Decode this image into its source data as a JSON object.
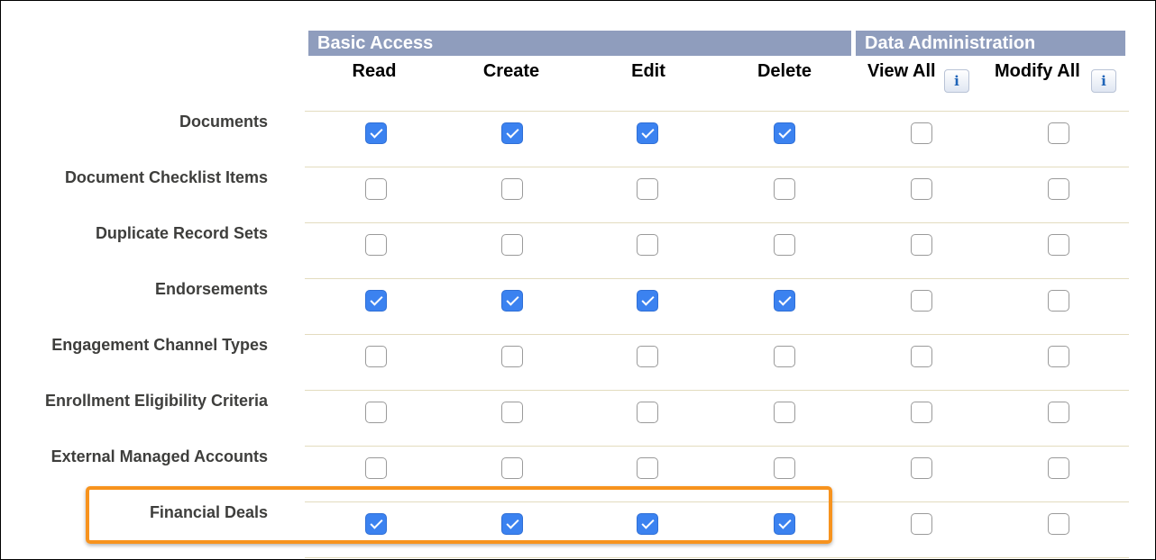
{
  "header": {
    "basic_access": "Basic Access",
    "data_administration": "Data Administration"
  },
  "columns": [
    "Read",
    "Create",
    "Edit",
    "Delete",
    "View All",
    "Modify All"
  ],
  "info_icon_glyph": "i",
  "rows": [
    {
      "label": "Documents",
      "read": true,
      "create": true,
      "edit": true,
      "delete": true,
      "view_all": false,
      "modify_all": false
    },
    {
      "label": "Document Checklist Items",
      "read": false,
      "create": false,
      "edit": false,
      "delete": false,
      "view_all": false,
      "modify_all": false
    },
    {
      "label": "Duplicate Record Sets",
      "read": false,
      "create": false,
      "edit": false,
      "delete": false,
      "view_all": false,
      "modify_all": false
    },
    {
      "label": "Endorsements",
      "read": true,
      "create": true,
      "edit": true,
      "delete": true,
      "view_all": false,
      "modify_all": false
    },
    {
      "label": "Engagement Channel Types",
      "read": false,
      "create": false,
      "edit": false,
      "delete": false,
      "view_all": false,
      "modify_all": false
    },
    {
      "label": "Enrollment Eligibility Criteria",
      "read": false,
      "create": false,
      "edit": false,
      "delete": false,
      "view_all": false,
      "modify_all": false
    },
    {
      "label": "External Managed Accounts",
      "read": false,
      "create": false,
      "edit": false,
      "delete": false,
      "view_all": false,
      "modify_all": false
    },
    {
      "label": "Financial Deals",
      "read": true,
      "create": true,
      "edit": true,
      "delete": true,
      "view_all": false,
      "modify_all": false
    }
  ],
  "highlighted_row": "Financial Deals",
  "colors": {
    "section_header_bg": "#8f9dbd",
    "checkbox_checked": "#3b82f0",
    "highlight_border": "#f7931e",
    "row_divider": "#e3dcbf"
  }
}
